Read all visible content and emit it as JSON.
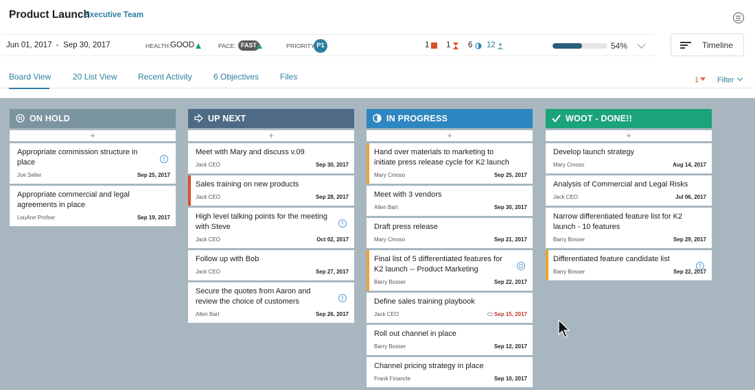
{
  "header": {
    "title": "Product Launch",
    "team": "Executive Team"
  },
  "meta": {
    "date_start": "Jun 01, 2017",
    "date_sep": "-",
    "date_end": "Sep 30, 2017",
    "health_label": "HEALTH:",
    "health_value": "GOOD",
    "pace_label": "PACE:",
    "pace_value": "FAST",
    "priority_label": "PRIORITY:",
    "priority_value": "P1",
    "count_a": "1",
    "count_b": "1",
    "count_c": "6",
    "count_d": "12",
    "progress_percent": 54,
    "progress_text": "54%",
    "status_colors": {
      "good": "#1ba37a",
      "brand": "#2a7fa0",
      "alert": "#d94f2b",
      "progress": "#2b5d7d"
    }
  },
  "timeline_button": "Timeline",
  "tabs": [
    {
      "label": "Board View"
    },
    {
      "label": "20 List View"
    },
    {
      "label": "Recent Activity"
    },
    {
      "label": "6 Objectives"
    },
    {
      "label": "Files"
    }
  ],
  "filter": {
    "count": "1",
    "label": "Filter"
  },
  "columns": [
    {
      "title": "ON HOLD",
      "icon": "pause-icon",
      "color": "#7a959f",
      "add": "+",
      "cards": [
        {
          "title": "Appropriate commission structure in place",
          "owner": "Joe Seller",
          "due": "Sep 25, 2017",
          "badge": "info-icon",
          "accent": ""
        },
        {
          "title": "Appropriate commercial and legal agreements in place",
          "owner": "LouAnn Profser",
          "due": "Sep 19, 2017",
          "badge": "",
          "accent": ""
        }
      ]
    },
    {
      "title": "UP NEXT",
      "icon": "arrow-right-icon",
      "color": "#4e6a85",
      "add": "+",
      "cards": [
        {
          "title": "Meet with Mary and discuss v.09",
          "owner": "Jack CEO",
          "due": "Sep 30, 2017",
          "badge": "",
          "accent": ""
        },
        {
          "title": "Sales training on new products",
          "owner": "Jack CEO",
          "due": "Sep 28, 2017",
          "badge": "",
          "accent": "#d94f2b"
        },
        {
          "title": "High level talking points for the meeting with Steve",
          "owner": "Jack CEO",
          "due": "Oct 02, 2017",
          "badge": "info-icon",
          "accent": ""
        },
        {
          "title": "Follow up with Bob",
          "owner": "Jack CEO",
          "due": "Sep 27, 2017",
          "badge": "",
          "accent": ""
        },
        {
          "title": "Secure the quotes from Aaron and review the choice of customers",
          "owner": "Allen Bart",
          "due": "Sep 26, 2017",
          "badge": "info-icon",
          "accent": ""
        }
      ]
    },
    {
      "title": "IN PROGRESS",
      "icon": "half-circle-icon",
      "color": "#2e86c1",
      "add": "+",
      "cards": [
        {
          "title": "Hand over materials to marketing to initiate press release cycle for K2 launch",
          "owner": "Mary Cmoso",
          "due": "Sep 25, 2017",
          "badge": "",
          "accent": "#f0a030"
        },
        {
          "title": "Meet with 3 vendors",
          "owner": "Allen Bart",
          "due": "Sep 30, 2017",
          "badge": "",
          "accent": ""
        },
        {
          "title": "Draft press release",
          "owner": "Mary Cmoso",
          "due": "Sep 21, 2017",
          "badge": "",
          "accent": ""
        },
        {
          "title": "Final list of 5 differentiated features for K2 launch -- Product Marketing",
          "owner": "Barry Bosser",
          "due": "Sep 22, 2017",
          "badge": "target-icon",
          "accent": "#f0a030"
        },
        {
          "title": "Define sales training playbook",
          "owner": "Jack CEO",
          "due": "Sep 15, 2017",
          "badge": "",
          "accent": "",
          "late": true
        },
        {
          "title": "Roll out channel in place",
          "owner": "Barry Bosser",
          "due": "Sep 12, 2017",
          "badge": "",
          "accent": ""
        },
        {
          "title": "Channel pricing strategy in place",
          "owner": "Frank Financle",
          "due": "Sep 10, 2017",
          "badge": "",
          "accent": ""
        }
      ]
    },
    {
      "title": "WOOT - DONE!!",
      "icon": "checkmark-icon",
      "color": "#1ba37a",
      "add": "+",
      "cards": [
        {
          "title": "Develop launch strategy",
          "owner": "Mary Cmoso",
          "due": "Aug 14, 2017",
          "badge": "",
          "accent": ""
        },
        {
          "title": "Analysis of Commercial and Legal Risks",
          "owner": "Jack CEO",
          "due": "Jul 06, 2017",
          "badge": "",
          "accent": ""
        },
        {
          "title": "Narrow differentiated feature list for K2 launch - 10 features",
          "owner": "Barry Bosser",
          "due": "Sep 29, 2017",
          "badge": "",
          "accent": ""
        },
        {
          "title": "Differentiated feature candidate list",
          "owner": "Barry Bosser",
          "due": "Sep 22, 2017",
          "badge": "info-icon",
          "accent": "#f0a030"
        }
      ]
    }
  ]
}
